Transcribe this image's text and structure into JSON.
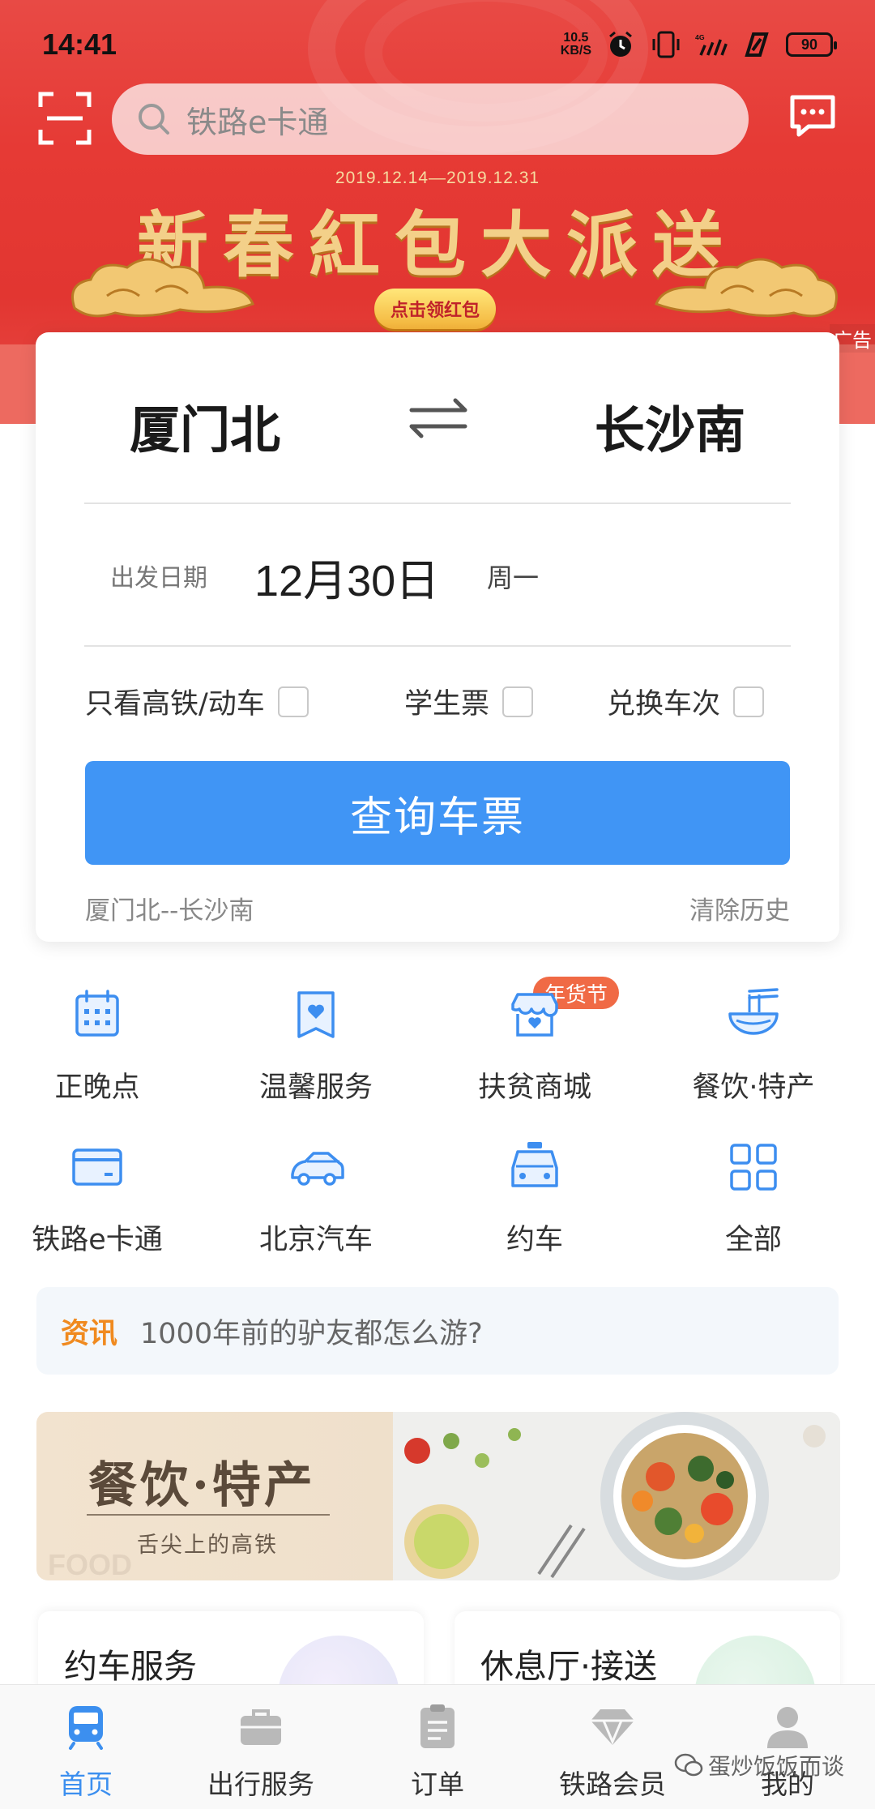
{
  "status_bar": {
    "time": "14:41",
    "net_speed_value": "10.5",
    "net_speed_unit": "KB/S",
    "signal": "4G",
    "battery": "90"
  },
  "header": {
    "search_placeholder": "铁路e卡通"
  },
  "promo": {
    "dates": "2019.12.14—2019.12.31",
    "title": "新春紅包大派送",
    "button": "点击领红包",
    "ad_tag": "广告"
  },
  "ticket": {
    "from_station": "厦门北",
    "to_station": "长沙南",
    "date_label": "出发日期",
    "date_value": "12月30日",
    "weekday": "周一",
    "options": [
      "只看高铁/动车",
      "学生票",
      "兑换车次"
    ],
    "query_button": "查询车票",
    "history": "厦门北--长沙南",
    "clear_history": "清除历史"
  },
  "services": [
    {
      "label": "正晚点",
      "icon": "calendar-icon"
    },
    {
      "label": "温馨服务",
      "icon": "heart-bookmark-icon"
    },
    {
      "label": "扶贫商城",
      "icon": "shop-icon",
      "badge": "年货节"
    },
    {
      "label": "餐饮·特产",
      "icon": "noodle-bowl-icon"
    },
    {
      "label": "铁路e卡通",
      "icon": "card-icon"
    },
    {
      "label": "北京汽车",
      "icon": "car-icon"
    },
    {
      "label": "约车",
      "icon": "taxi-icon"
    },
    {
      "label": "全部",
      "icon": "grid-icon"
    }
  ],
  "news": {
    "tag": "资讯",
    "text": "1000年前的驴友都怎么游?"
  },
  "food_banner": {
    "title": "餐饮·特产",
    "subtitle": "舌尖上的高铁",
    "bg_word": "FOOD"
  },
  "cards": {
    "left": "约车服务",
    "right": "休息厅·接送"
  },
  "bottom_nav": [
    {
      "label": "首页",
      "icon": "train-icon",
      "active": true
    },
    {
      "label": "出行服务",
      "icon": "briefcase-icon",
      "active": false
    },
    {
      "label": "订单",
      "icon": "clipboard-icon",
      "active": false
    },
    {
      "label": "铁路会员",
      "icon": "diamond-icon",
      "active": false
    },
    {
      "label": "我的",
      "icon": "user-icon",
      "active": false
    }
  ],
  "watermark": "蛋炒饭饭而谈",
  "colors": {
    "brand_blue": "#4095f5",
    "banner_red": "#e63a35",
    "accent_orange": "#f08a1f",
    "badge_orange": "#f06a45"
  }
}
